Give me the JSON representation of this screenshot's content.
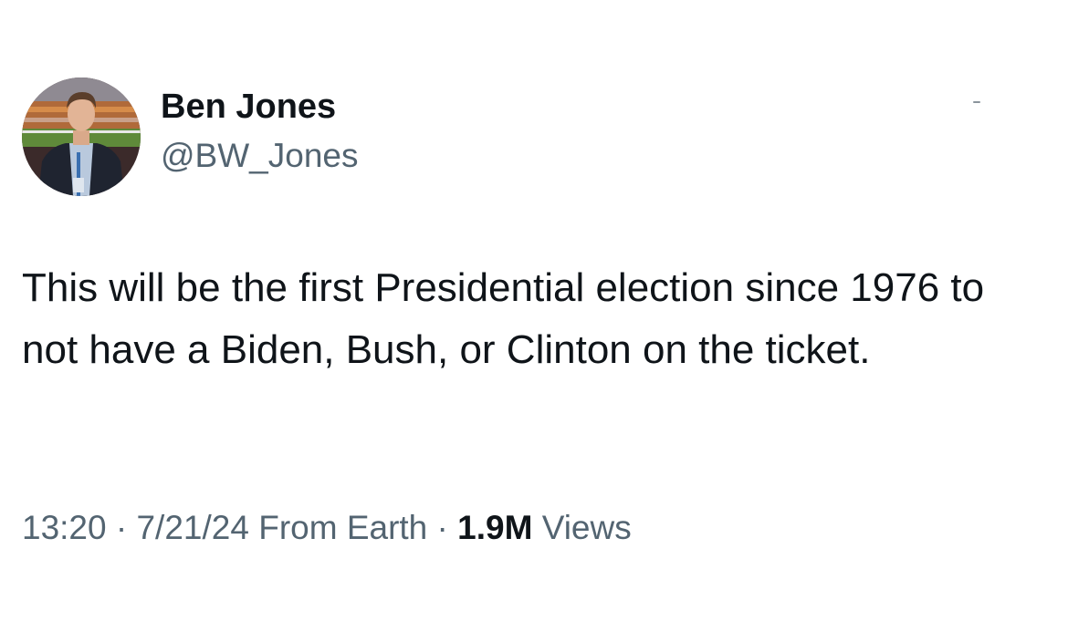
{
  "author": {
    "display_name": "Ben Jones",
    "handle": "@BW_Jones",
    "avatar_icon": "profile-photo"
  },
  "tweet": {
    "text": "This will be the first Presidential election since 1976 to not have a Biden, Bush, or Clinton on the ticket."
  },
  "meta": {
    "time": "13:20",
    "separator": "·",
    "date": "7/21/24",
    "source": "From Earth",
    "views_count": "1.9M",
    "views_label": "Views"
  },
  "colors": {
    "text_primary": "#0f1419",
    "text_secondary": "#536471",
    "background": "#ffffff"
  }
}
